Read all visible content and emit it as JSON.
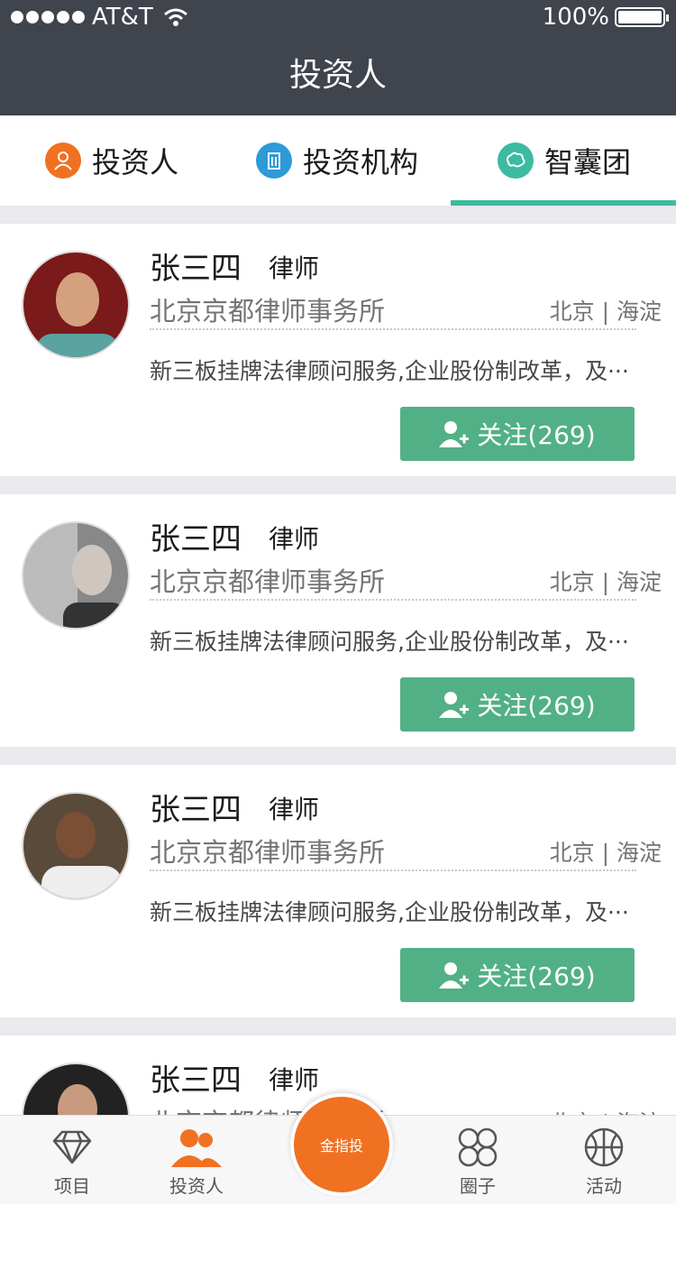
{
  "status": {
    "carrier": "AT&T",
    "battery": "100%"
  },
  "navbar": {
    "title": "投资人"
  },
  "tabs": [
    {
      "label": "投资人",
      "icon": "person-icon",
      "color": "#f07122"
    },
    {
      "label": "投资机构",
      "icon": "building-icon",
      "color": "#2e9ad7"
    },
    {
      "label": "智囊团",
      "icon": "brain-icon",
      "color": "#3dbba0",
      "active": true
    }
  ],
  "cards": [
    {
      "name": "张三四",
      "role": "律师",
      "firm": "北京京都律师事务所",
      "location": "北京 | 海淀",
      "desc": "新三板挂牌法律顾问服务,企业股份制改革，及···",
      "follow": "关注(269)"
    },
    {
      "name": "张三四",
      "role": "律师",
      "firm": "北京京都律师事务所",
      "location": "北京 | 海淀",
      "desc": "新三板挂牌法律顾问服务,企业股份制改革，及···",
      "follow": "关注(269)"
    },
    {
      "name": "张三四",
      "role": "律师",
      "firm": "北京京都律师事务所",
      "location": "北京 | 海淀",
      "desc": "新三板挂牌法律顾问服务,企业股份制改革，及···",
      "follow": "关注(269)"
    },
    {
      "name": "张三四",
      "role": "律师",
      "firm": "北京京都律师事务所",
      "location": "北京 | 海淀",
      "desc": "",
      "follow": ""
    }
  ],
  "bottom_nav": [
    {
      "label": "项目",
      "icon": "diamond-icon"
    },
    {
      "label": "投资人",
      "icon": "people-icon",
      "active": true
    },
    {
      "label": "金指投",
      "icon": "logo-icon"
    },
    {
      "label": "圈子",
      "icon": "circles-icon"
    },
    {
      "label": "活动",
      "icon": "basketball-icon"
    }
  ],
  "colors": {
    "header": "#3f444d",
    "accent": "#3dbba0",
    "follow": "#52b086",
    "orange": "#f07122"
  }
}
